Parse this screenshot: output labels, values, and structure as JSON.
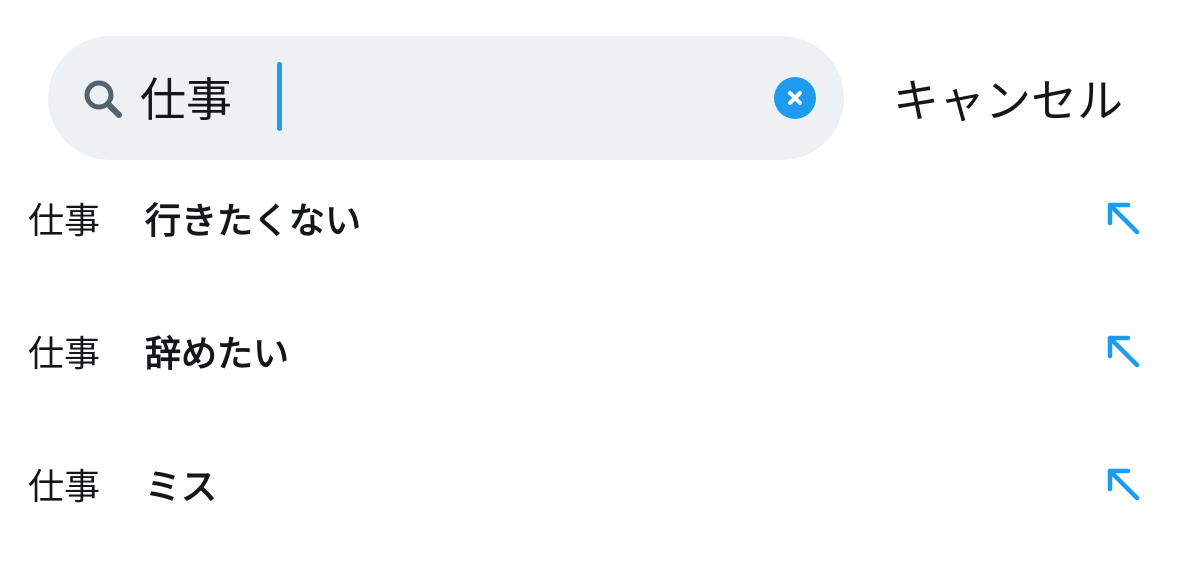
{
  "search": {
    "query": "仕事",
    "clear_icon": "clear-circle-icon",
    "cancel_label": "キャンセル",
    "icon": "search-icon"
  },
  "suggestions": [
    {
      "query": "仕事",
      "completion": "行きたくない",
      "icon": "fill-query-arrow-icon"
    },
    {
      "query": "仕事",
      "completion": "辞めたい",
      "icon": "fill-query-arrow-icon"
    },
    {
      "query": "仕事",
      "completion": "ミス",
      "icon": "fill-query-arrow-icon"
    }
  ],
  "colors": {
    "accent": "#1d9bf0",
    "search_background": "#eef1f3",
    "search_icon": "#536471",
    "text": "#14171a"
  }
}
